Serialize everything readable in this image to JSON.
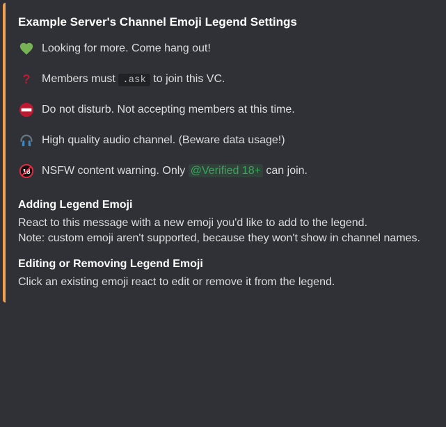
{
  "title": "Example Server's Channel Emoji Legend Settings",
  "legend": [
    {
      "emoji_name": "green-heart",
      "text": "Looking for more. Come hang out!"
    },
    {
      "emoji_name": "question-mark",
      "pre": "Members must ",
      "code": ".ask",
      "post": " to join this VC."
    },
    {
      "emoji_name": "no-entry",
      "text": "Do not disturb. Not accepting members at this time."
    },
    {
      "emoji_name": "headphones",
      "text": "High quality audio channel. (Beware data usage!)"
    },
    {
      "emoji_name": "eighteen-plus",
      "pre": "NSFW content warning. Only ",
      "mention": "@Verified 18+",
      "post": " can join."
    }
  ],
  "sections": {
    "adding": {
      "heading": "Adding Legend Emoji",
      "body": "React to this message with a new emoji you'd like to add to the legend.\nNote: custom emoji aren't supported, because they won't show in channel names."
    },
    "editing": {
      "heading": "Editing or Removing Legend Emoji",
      "body": "Click an existing emoji react to edit or remove it from the legend."
    }
  }
}
